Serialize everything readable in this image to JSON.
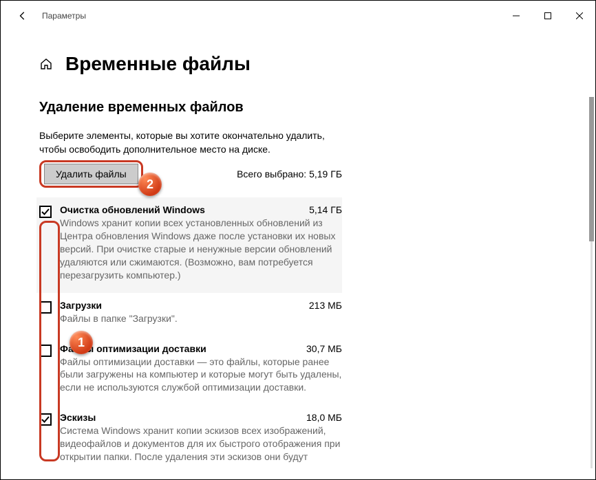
{
  "window": {
    "app_title": "Параметры"
  },
  "page": {
    "title": "Временные файлы",
    "section_title": "Удаление временных файлов",
    "instruction_line1": "Выберите элементы, которые вы хотите окончательно удалить,",
    "instruction_line2": "чтобы освободить дополнительное место на диске.",
    "remove_button": "Удалить файлы",
    "total_prefix": "Всего выбрано: ",
    "total_value": "5,19 ГБ"
  },
  "items": [
    {
      "checked": true,
      "title": "Очистка обновлений Windows",
      "size": "5,14 ГБ",
      "desc": "Windows хранит копии всех установленных обновлений из Центра обновления Windows даже после установки их новых версий. При очистке старые и ненужные версии обновлений удаляются или сжимаются. (Возможно, вам потребуется перезагрузить компьютер.)"
    },
    {
      "checked": false,
      "title": "Загрузки",
      "size": "213 МБ",
      "desc": "Файлы в папке \"Загрузки\"."
    },
    {
      "checked": false,
      "title": "Файлы оптимизации доставки",
      "size": "30,7 МБ",
      "desc": "Файлы оптимизации доставки — это файлы, которые ранее были загружены на компьютер и которые могут быть удалены, если не используются службой оптимизации доставки."
    },
    {
      "checked": true,
      "title": "Эскизы",
      "size": "18,0 МБ",
      "desc": "Система Windows хранит копии эскизов всех изображений, видеофайлов и документов для их быстрого отображения при открытии папки. После удаления эти эскизов они будут"
    }
  ],
  "badges": {
    "one": "1",
    "two": "2"
  }
}
